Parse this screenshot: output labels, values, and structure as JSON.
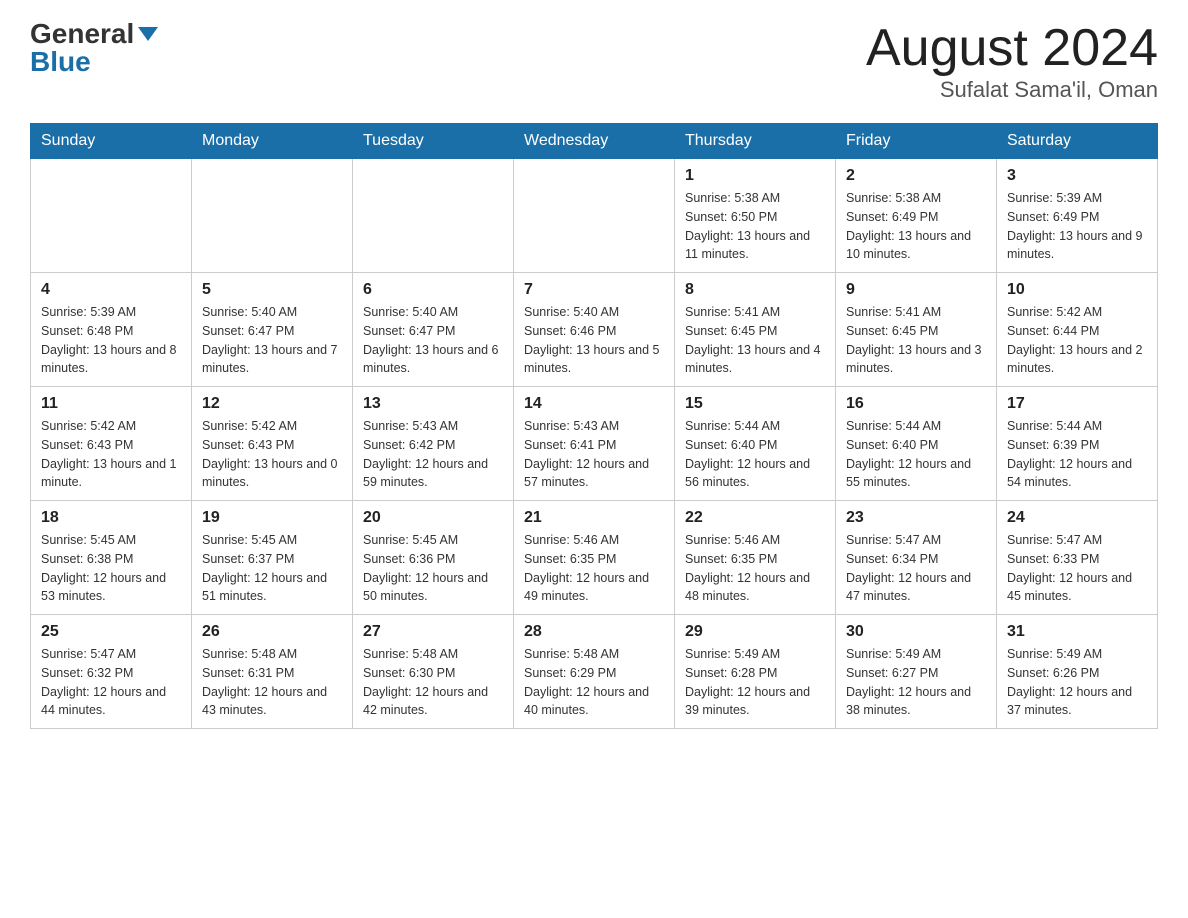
{
  "header": {
    "logo_general": "General",
    "logo_blue": "Blue",
    "month_title": "August 2024",
    "location": "Sufalat Sama'il, Oman"
  },
  "weekdays": [
    "Sunday",
    "Monday",
    "Tuesday",
    "Wednesday",
    "Thursday",
    "Friday",
    "Saturday"
  ],
  "weeks": [
    [
      {
        "day": "",
        "info": ""
      },
      {
        "day": "",
        "info": ""
      },
      {
        "day": "",
        "info": ""
      },
      {
        "day": "",
        "info": ""
      },
      {
        "day": "1",
        "info": "Sunrise: 5:38 AM\nSunset: 6:50 PM\nDaylight: 13 hours and 11 minutes."
      },
      {
        "day": "2",
        "info": "Sunrise: 5:38 AM\nSunset: 6:49 PM\nDaylight: 13 hours and 10 minutes."
      },
      {
        "day": "3",
        "info": "Sunrise: 5:39 AM\nSunset: 6:49 PM\nDaylight: 13 hours and 9 minutes."
      }
    ],
    [
      {
        "day": "4",
        "info": "Sunrise: 5:39 AM\nSunset: 6:48 PM\nDaylight: 13 hours and 8 minutes."
      },
      {
        "day": "5",
        "info": "Sunrise: 5:40 AM\nSunset: 6:47 PM\nDaylight: 13 hours and 7 minutes."
      },
      {
        "day": "6",
        "info": "Sunrise: 5:40 AM\nSunset: 6:47 PM\nDaylight: 13 hours and 6 minutes."
      },
      {
        "day": "7",
        "info": "Sunrise: 5:40 AM\nSunset: 6:46 PM\nDaylight: 13 hours and 5 minutes."
      },
      {
        "day": "8",
        "info": "Sunrise: 5:41 AM\nSunset: 6:45 PM\nDaylight: 13 hours and 4 minutes."
      },
      {
        "day": "9",
        "info": "Sunrise: 5:41 AM\nSunset: 6:45 PM\nDaylight: 13 hours and 3 minutes."
      },
      {
        "day": "10",
        "info": "Sunrise: 5:42 AM\nSunset: 6:44 PM\nDaylight: 13 hours and 2 minutes."
      }
    ],
    [
      {
        "day": "11",
        "info": "Sunrise: 5:42 AM\nSunset: 6:43 PM\nDaylight: 13 hours and 1 minute."
      },
      {
        "day": "12",
        "info": "Sunrise: 5:42 AM\nSunset: 6:43 PM\nDaylight: 13 hours and 0 minutes."
      },
      {
        "day": "13",
        "info": "Sunrise: 5:43 AM\nSunset: 6:42 PM\nDaylight: 12 hours and 59 minutes."
      },
      {
        "day": "14",
        "info": "Sunrise: 5:43 AM\nSunset: 6:41 PM\nDaylight: 12 hours and 57 minutes."
      },
      {
        "day": "15",
        "info": "Sunrise: 5:44 AM\nSunset: 6:40 PM\nDaylight: 12 hours and 56 minutes."
      },
      {
        "day": "16",
        "info": "Sunrise: 5:44 AM\nSunset: 6:40 PM\nDaylight: 12 hours and 55 minutes."
      },
      {
        "day": "17",
        "info": "Sunrise: 5:44 AM\nSunset: 6:39 PM\nDaylight: 12 hours and 54 minutes."
      }
    ],
    [
      {
        "day": "18",
        "info": "Sunrise: 5:45 AM\nSunset: 6:38 PM\nDaylight: 12 hours and 53 minutes."
      },
      {
        "day": "19",
        "info": "Sunrise: 5:45 AM\nSunset: 6:37 PM\nDaylight: 12 hours and 51 minutes."
      },
      {
        "day": "20",
        "info": "Sunrise: 5:45 AM\nSunset: 6:36 PM\nDaylight: 12 hours and 50 minutes."
      },
      {
        "day": "21",
        "info": "Sunrise: 5:46 AM\nSunset: 6:35 PM\nDaylight: 12 hours and 49 minutes."
      },
      {
        "day": "22",
        "info": "Sunrise: 5:46 AM\nSunset: 6:35 PM\nDaylight: 12 hours and 48 minutes."
      },
      {
        "day": "23",
        "info": "Sunrise: 5:47 AM\nSunset: 6:34 PM\nDaylight: 12 hours and 47 minutes."
      },
      {
        "day": "24",
        "info": "Sunrise: 5:47 AM\nSunset: 6:33 PM\nDaylight: 12 hours and 45 minutes."
      }
    ],
    [
      {
        "day": "25",
        "info": "Sunrise: 5:47 AM\nSunset: 6:32 PM\nDaylight: 12 hours and 44 minutes."
      },
      {
        "day": "26",
        "info": "Sunrise: 5:48 AM\nSunset: 6:31 PM\nDaylight: 12 hours and 43 minutes."
      },
      {
        "day": "27",
        "info": "Sunrise: 5:48 AM\nSunset: 6:30 PM\nDaylight: 12 hours and 42 minutes."
      },
      {
        "day": "28",
        "info": "Sunrise: 5:48 AM\nSunset: 6:29 PM\nDaylight: 12 hours and 40 minutes."
      },
      {
        "day": "29",
        "info": "Sunrise: 5:49 AM\nSunset: 6:28 PM\nDaylight: 12 hours and 39 minutes."
      },
      {
        "day": "30",
        "info": "Sunrise: 5:49 AM\nSunset: 6:27 PM\nDaylight: 12 hours and 38 minutes."
      },
      {
        "day": "31",
        "info": "Sunrise: 5:49 AM\nSunset: 6:26 PM\nDaylight: 12 hours and 37 minutes."
      }
    ]
  ]
}
